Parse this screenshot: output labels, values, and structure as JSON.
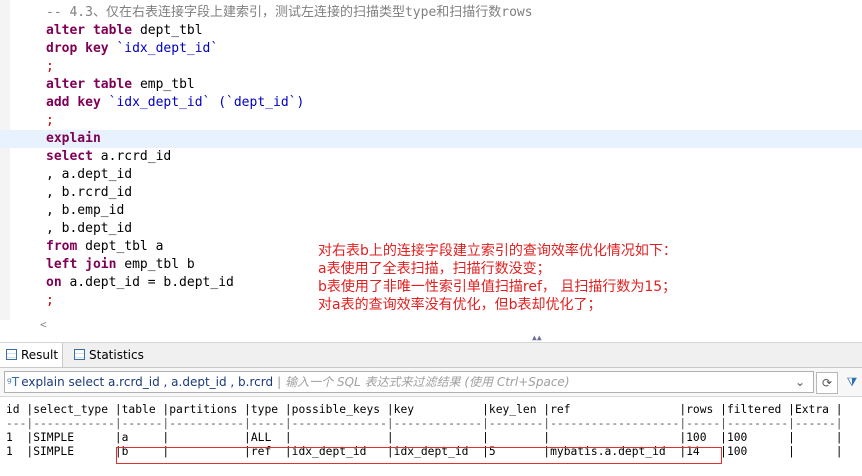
{
  "editor": {
    "comment": "-- 4.3、仅在右表连接字段上建索引，测试左连接的扫描类型type和扫描行数rows",
    "kw_alter1": "alter",
    "kw_table1": "table",
    "t_dept_tbl": "dept_tbl",
    "kw_drop": "drop",
    "kw_key1": "key",
    "s_idx1": "`idx_dept_id`",
    "semi": ";",
    "kw_alter2": "alter",
    "kw_table2": "table",
    "t_emp_tbl": "emp_tbl",
    "kw_add": "add",
    "kw_key2": "key",
    "s_idx2": "`idx_dept_id`",
    "s_col": "(`dept_id`)",
    "kw_explain": "explain",
    "kw_select": "select",
    "sel1": "a.rcrd_id",
    "sel2": ", a.dept_id",
    "sel3": ", b.rcrd_id",
    "sel4": ", b.emp_id",
    "sel5": ", b.dept_id",
    "kw_from": "from",
    "from_tbl": "dept_tbl a",
    "kw_left": "left",
    "kw_join": "join",
    "join_tbl": "emp_tbl b",
    "kw_on": "on",
    "on_cond": "a.dept_id = b.dept_id"
  },
  "note": {
    "line1": "对右表b上的连接字段建立索引的查询效率优化情况如下：",
    "line2": "a表使用了全表扫描，扫描行数没变；",
    "line3": "b表使用了非唯一性索引单值扫描ref， 且扫描行数为15；",
    "line4": "对a表的查询效率没有优化，但b表却优化了；"
  },
  "scroll_left_glyph": "<",
  "tabs": {
    "result": "Result",
    "statistics": "Statistics"
  },
  "filter": {
    "sql": "explain select a.rcrd_id , a.dept_id , b.rcrd",
    "placeholder": "输入一个 SQL 表达式来过滤结果 (使用 Ctrl+Space)",
    "dropdown_glyph": "⌄",
    "refresh_glyph": "⟳",
    "filter_glyph": "⧩"
  },
  "results": {
    "header": "id |select_type |table |partitions |type |possible_keys |key          |key_len |ref                |rows |filtered |Extra |",
    "divider": "---|------------|------|-----------|-----|--------------|-------------|--------|-------------------|-----|---------|------|",
    "row1": "1  |SIMPLE      |a     |           |ALL  |              |             |        |                   |100  |100      |      |",
    "row2": "1  |SIMPLE      |b     |           |ref  |idx_dept_id   |idx_dept_id  |5       |mybatis.a.dept_id  |14   |100      |      |"
  },
  "colors": {
    "keyword": "#7f0055",
    "string": "#0000c0",
    "comment": "#808080",
    "note": "#e02020",
    "highlight_border": "#e03030"
  }
}
